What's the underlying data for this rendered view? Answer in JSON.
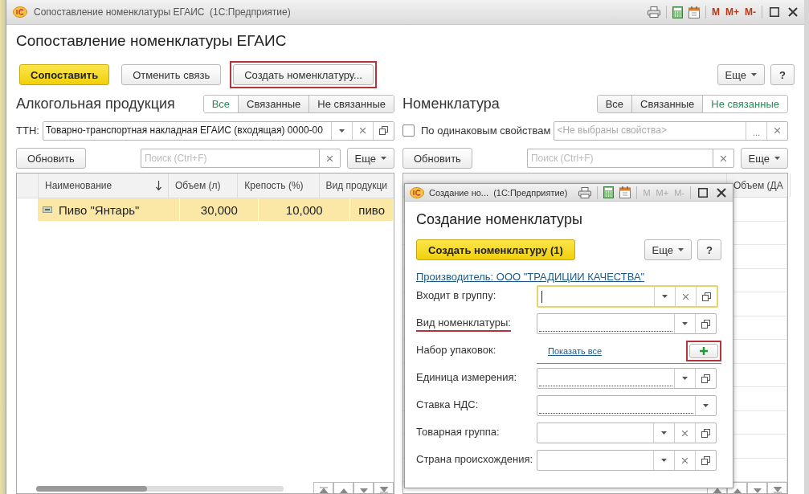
{
  "window": {
    "title": "Сопоставление номенклатуры ЕГАИС  (1С:Предприятие)",
    "memory_buttons": [
      "M",
      "M+",
      "M-"
    ]
  },
  "form_title": "Сопоставление номенклатуры ЕГАИС",
  "toolbar": {
    "buttons": [
      {
        "label": "Сопоставить",
        "kind": "primary",
        "highlighted": false
      },
      {
        "label": "Отменить связь",
        "kind": "normal",
        "highlighted": false
      },
      {
        "label": "Создать номенклатуру...",
        "kind": "normal",
        "highlighted": true
      }
    ],
    "more": "Еще",
    "help": "?"
  },
  "left_pane": {
    "title": "Алкогольная продукция",
    "filters": [
      {
        "label": "Все",
        "selected": true
      },
      {
        "label": "Связанные",
        "selected": false
      },
      {
        "label": "Не связанные",
        "selected": false
      }
    ],
    "ttn": {
      "label": "ТТН:",
      "value": "Товарно-транспортная накладная ЕГАИС (входящая) 0000-00"
    },
    "refresh": "Обновить",
    "search": {
      "placeholder": "Поиск (Ctrl+F)"
    },
    "more": "Еще",
    "table": {
      "columns": [
        {
          "label": "Наименование",
          "sorted": true
        },
        {
          "label": "Объем (л)",
          "sorted": false
        },
        {
          "label": "Крепость (%)",
          "sorted": false
        },
        {
          "label": "Вид продукци",
          "sorted": false
        }
      ],
      "rows": [
        {
          "cells": [
            "Пиво \"Янтарь\"",
            "30,000",
            "10,000",
            "пиво"
          ],
          "selected": true
        }
      ]
    }
  },
  "right_pane": {
    "title": "Номенклатура",
    "filters": [
      {
        "label": "Все",
        "selected": false
      },
      {
        "label": "Связанные",
        "selected": false
      },
      {
        "label": "Не связанные",
        "selected": true
      }
    ],
    "same_properties": {
      "label": "По одинаковым свойствам",
      "checked": false
    },
    "properties": {
      "placeholder": "<Не выбраны свойства>",
      "choose": "..."
    },
    "refresh": "Обновить",
    "search": {
      "placeholder": "Поиск (Ctrl+F)"
    },
    "more": "Еще",
    "table": {
      "columns": [
        {
          "label": "Объем (ДА",
          "sorted": false
        }
      ]
    }
  },
  "dialog": {
    "title": "Создание но...  (1С:Предприятие)",
    "memory_buttons": [
      "M",
      "M+",
      "M-"
    ],
    "heading": "Создание номенклатуры",
    "create_button": "Создать номенклатуру (1)",
    "more": "Еще",
    "help": "?",
    "producer_link": "Производитель: ООО \"ТРАДИЦИИ КАЧЕСТВА\"",
    "fields": [
      {
        "label": "Входит в группу:",
        "kind": "select",
        "clear_button": true,
        "open_button": true,
        "focused": true,
        "required": false,
        "highlighted": false
      },
      {
        "label": "Вид номенклатуры:",
        "kind": "select",
        "clear_button": false,
        "open_button": true,
        "focused": false,
        "required": true,
        "highlighted": true
      },
      {
        "label": "Набор упаковок:",
        "kind": "list",
        "link": "Показать все",
        "add_highlighted": true
      },
      {
        "label": "Единица измерения:",
        "kind": "select",
        "clear_button": false,
        "open_button": true,
        "focused": false,
        "required": true,
        "highlighted": false
      },
      {
        "label": "Ставка НДС:",
        "kind": "select",
        "clear_button": false,
        "open_button": false,
        "focused": false,
        "required": true,
        "highlighted": false
      },
      {
        "label": "Товарная группа:",
        "kind": "select",
        "clear_button": true,
        "open_button": true,
        "focused": false,
        "required": false,
        "highlighted": false
      },
      {
        "label": "Страна происхождения:",
        "kind": "select",
        "clear_button": true,
        "open_button": true,
        "focused": false,
        "required": false,
        "highlighted": false
      }
    ]
  }
}
